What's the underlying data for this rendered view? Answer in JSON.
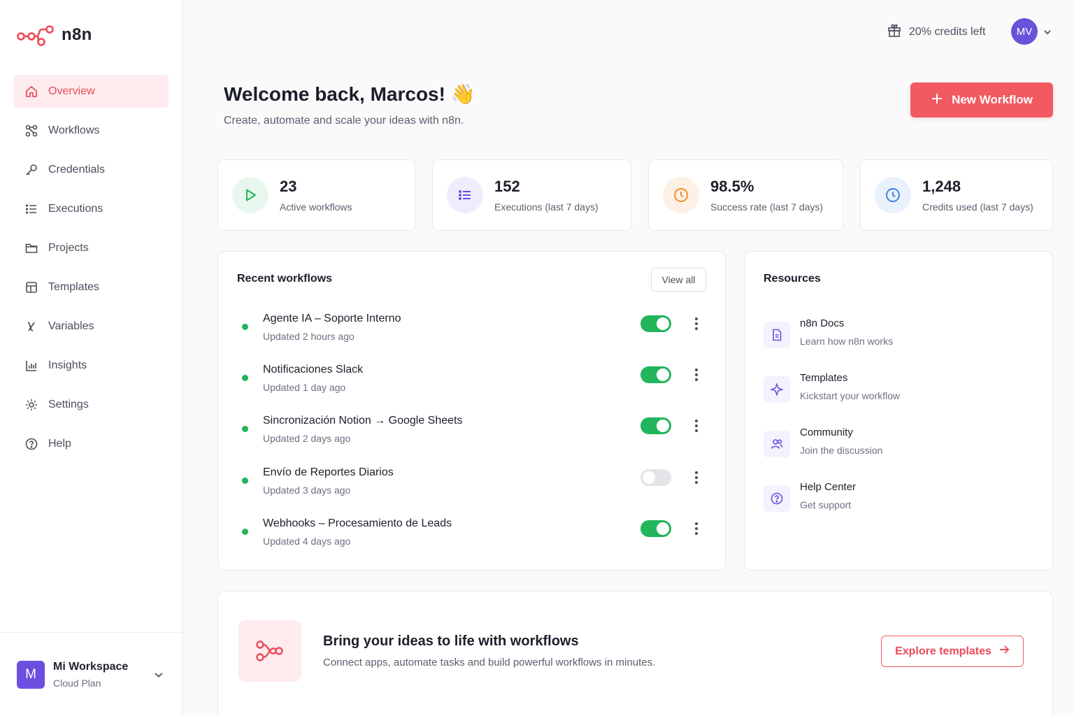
{
  "app": {
    "name": "n8n"
  },
  "sidebar": {
    "items": [
      {
        "label": "Overview",
        "icon": "home-icon",
        "active": true
      },
      {
        "label": "Workflows",
        "icon": "workflow-icon"
      },
      {
        "label": "Credentials",
        "icon": "key-icon"
      },
      {
        "label": "Executions",
        "icon": "list-icon"
      },
      {
        "label": "Projects",
        "icon": "folder-icon"
      },
      {
        "label": "Templates",
        "icon": "template-icon"
      },
      {
        "label": "Variables",
        "icon": "variable-icon"
      },
      {
        "label": "Insights",
        "icon": "chart-icon"
      },
      {
        "label": "Settings",
        "icon": "gear-icon"
      },
      {
        "label": "Help",
        "icon": "help-icon"
      }
    ],
    "workspace": {
      "initial": "M",
      "name": "Mi Workspace",
      "plan": "Cloud Plan"
    }
  },
  "header": {
    "credits": "20% credits left",
    "avatar_initials": "MV"
  },
  "welcome": {
    "title": "Welcome back, Marcos! 👋",
    "subtitle": "Create, automate and scale your ideas with n8n.",
    "new_button": "New Workflow"
  },
  "stats": [
    {
      "value": "23",
      "label": "Active workflows",
      "icon": "play-icon",
      "color": "#22b55c",
      "bg": "#e8f7ee"
    },
    {
      "value": "152",
      "label": "Executions (last 7 days)",
      "icon": "list-icon",
      "color": "#6b4fe0",
      "bg": "#efedfb"
    },
    {
      "value": "98.5%",
      "label": "Success rate (last 7 days)",
      "icon": "clock-icon",
      "color": "#f08a24",
      "bg": "#fdf0e4"
    },
    {
      "value": "1,248",
      "label": "Credits used (last 7 days)",
      "icon": "clock-icon",
      "color": "#3b7fe0",
      "bg": "#e8f1fc"
    }
  ],
  "recent": {
    "title": "Recent workflows",
    "view_all": "View all",
    "items": [
      {
        "name": "Agente IA – Soporte Interno",
        "updated": "Updated 2 hours ago",
        "active": true
      },
      {
        "name": "Notificaciones Slack",
        "updated": "Updated 1 day ago",
        "active": true
      },
      {
        "name": "Sincronización Notion → Google Sheets",
        "updated": "Updated 2 days ago",
        "active": true
      },
      {
        "name": "Envío de Reportes Diarios",
        "updated": "Updated 3 days ago",
        "active": false
      },
      {
        "name": "Webhooks – Procesamiento de Leads",
        "updated": "Updated 4 days ago",
        "active": true
      }
    ]
  },
  "resources": {
    "title": "Resources",
    "items": [
      {
        "title": "n8n Docs",
        "subtitle": "Learn how n8n works",
        "icon": "doc-icon"
      },
      {
        "title": "Templates",
        "subtitle": "Kickstart your workflow",
        "icon": "sparkle-icon"
      },
      {
        "title": "Community",
        "subtitle": "Join the discussion",
        "icon": "users-icon"
      },
      {
        "title": "Help Center",
        "subtitle": "Get support",
        "icon": "help-icon"
      }
    ]
  },
  "banner": {
    "title": "Bring your ideas to life with workflows",
    "subtitle": "Connect apps, automate tasks and build powerful workflows in minutes.",
    "button": "Explore templates"
  },
  "colors": {
    "accent": "#f15a61",
    "accent_text": "#ea4b58",
    "success": "#22b55c",
    "avatar": "#6a52d9"
  }
}
